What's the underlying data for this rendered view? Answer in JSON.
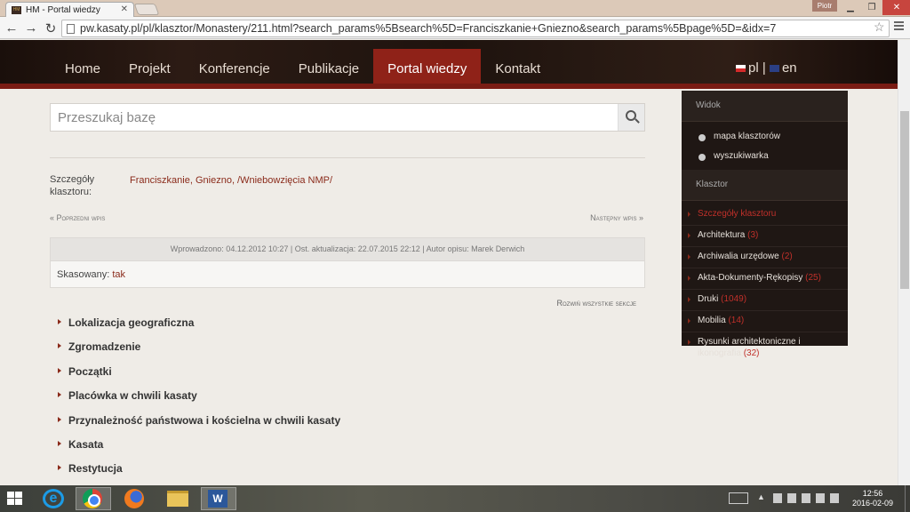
{
  "browser": {
    "tab_title": "HM - Portal wiedzy",
    "tab_favicon": "HM",
    "user": "Piotr",
    "url": "pw.kasaty.pl/pl/klasztor/Monastery/211.html?search_params%5Bsearch%5D=Franciszkanie+Gniezno&search_params%5Bpage%5D=&idx=7"
  },
  "nav": {
    "items": [
      "Home",
      "Projekt",
      "Konferencje",
      "Publikacje",
      "Portal wiedzy",
      "Kontakt"
    ],
    "active": "Portal wiedzy",
    "lang_pl": "pl",
    "lang_sep": "|",
    "lang_en": "en"
  },
  "search": {
    "placeholder": "Przeszukaj bazę"
  },
  "details": {
    "label": "Szczegóły klasztoru:",
    "value": "Franciszkanie, Gniezno, /Wniebowzięcia NMP/",
    "prev": "« Poprzedni wpis",
    "next": "Następny wpis »",
    "meta": "Wprowadzono: 04.12.2012 10:27 | Ost. aktualizacja: 22.07.2015 22:12 | Autor opisu: Marek Derwich",
    "deleted_label": "Skasowany:",
    "deleted_value": "tak",
    "expand_all": "Rozwiń wszystkie sekcje"
  },
  "sections": [
    "Lokalizacja geograficzna",
    "Zgromadzenie",
    "Początki",
    "Placówka w chwili kasaty",
    "Przynależność państwowa i kościelna w chwili kasaty",
    "Kasata",
    "Restytucja"
  ],
  "sidebar": {
    "view_title": "Widok",
    "view_items": [
      "mapa klasztorów",
      "wyszukiwarka"
    ],
    "klasztor_title": "Klasztor",
    "klasztor_items": [
      {
        "label": "Szczegóły klasztoru",
        "count": ""
      },
      {
        "label": "Architektura",
        "count": "(3)"
      },
      {
        "label": "Archiwalia urzędowe",
        "count": "(2)"
      },
      {
        "label": "Akta-Dokumenty-Rękopisy",
        "count": "(25)"
      },
      {
        "label": "Druki",
        "count": "(1049)"
      },
      {
        "label": "Mobilia",
        "count": "(14)"
      },
      {
        "label": "Rysunki architektoniczne i ikonografia",
        "count": "(32)"
      }
    ]
  },
  "taskbar": {
    "time": "12:56",
    "date": "2016-02-09"
  },
  "colors": {
    "accent": "#8f2218",
    "link": "#8a2a1a"
  }
}
